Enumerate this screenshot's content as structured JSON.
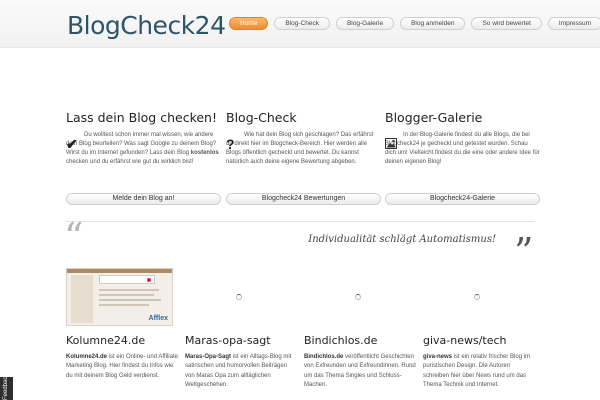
{
  "logo": "BlogCheck24",
  "nav": [
    "Home",
    "Blog-Check",
    "Blog-Galerie",
    "Blog anmelden",
    "So wird bewertet",
    "Impressum"
  ],
  "columns": [
    {
      "title": "Lass dein Blog checken!",
      "icon": "checkmark-icon",
      "text_pre": "Du wolltest schon immer mal wissen, wie andere dein Blog beurteilen? Was sagt Google zu deinem Blog? Wirst du im Internet gefunden? Lass dein Blog ",
      "text_bold": "kostenlos",
      "text_post": " checken und du erfährst wie gut du wirklich bist!",
      "button": "Melde dein Blog an!"
    },
    {
      "title": "Blog-Check",
      "icon": "question-mark-icon",
      "text": "Wie hat dein Blog sich geschlagen? Das erfährst du direkt hier im Blogcheck-Bereich. Hier werden alle Blogs öffentlich gecheckt und bewertet. Du kannst natürlich auch deine eigene Bewertung abgeben.",
      "button": "Blogcheck24 Bewertungen"
    },
    {
      "title": "Blogger-Galerie",
      "icon": "image-icon",
      "text": "In der Blog-Galerie findest du alle Blogs, die bei Blogcheck24 je gecheckt und getestet wurden. Schau dich um! Vielleicht findest du die eine oder andere Idee für deinen eigenen Blog!",
      "button": "Blogcheck24-Galerie"
    }
  ],
  "slogan": "Individualität schlägt Automatismus!",
  "sites": [
    {
      "title": "Kolumne24.de",
      "bold": "Kolumne24.de",
      "text": " ist ein Online- und Affiliate Marketing Blog. Hier findest du Infos wie du mit deinem Blog Geld verdienst.",
      "thumb_label": "Afflex"
    },
    {
      "title": "Maras-opa-sagt",
      "bold": "Maras-Opa-Sagt",
      "text": " ist ein Alltags-Blog mit satirischen und humorvollen Beiträgen von Maras Opa zum alltäglichen Weltgeschehen."
    },
    {
      "title": "Bindichlos.de",
      "bold": "Bindichlos.de",
      "text": " veröffentlicht Geschichten von Exfreunden und Exfreundinnen. Rund um das Thema Singles und Schluss-Machen."
    },
    {
      "title": "giva-news/tech",
      "bold": "giva-news",
      "text": " ist ein relativ frischer Blog im puristischen Design. Die Autoren schreiben hier über News rund um das Thema Technik und Internet."
    }
  ],
  "feedback": "Feedback"
}
